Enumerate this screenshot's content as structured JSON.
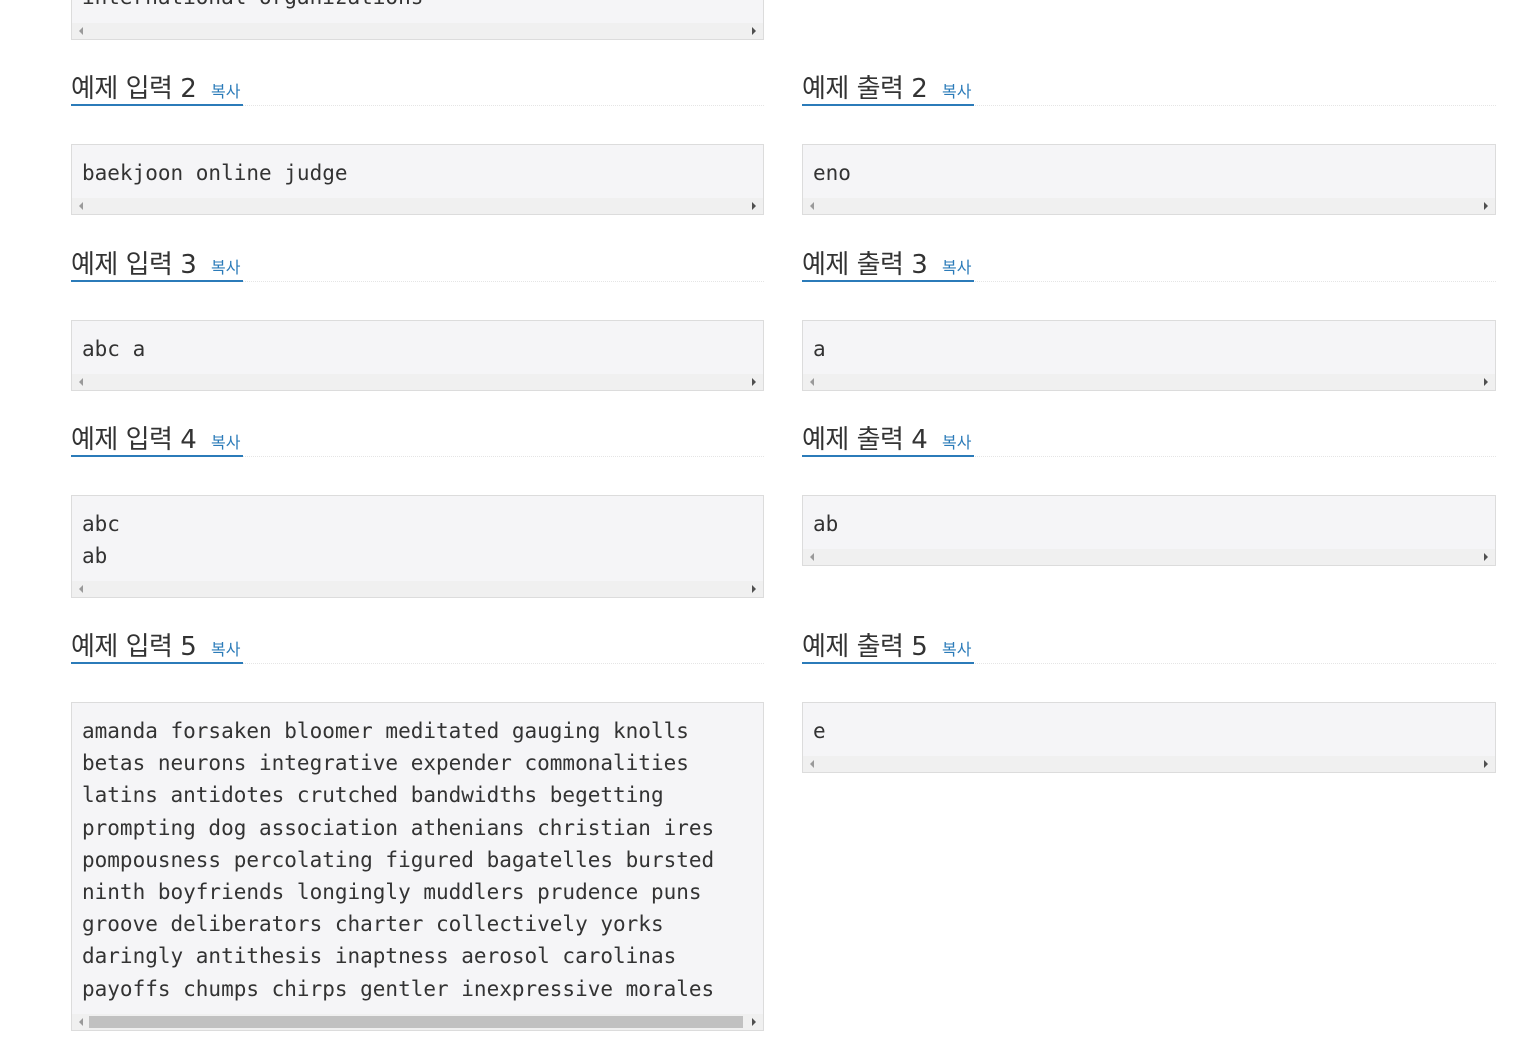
{
  "copy_label": "복사",
  "top_partial": {
    "text": "international organizations"
  },
  "inputs": [
    {
      "title": "예제 입력 2",
      "text": "baekjoon online judge"
    },
    {
      "title": "예제 입력 3",
      "text": "abc a"
    },
    {
      "title": "예제 입력 4",
      "text": "abc\nab"
    },
    {
      "title": "예제 입력 5",
      "text": "amanda forsaken bloomer meditated gauging knolls\nbetas neurons integrative expender commonalities\nlatins antidotes crutched bandwidths begetting\nprompting dog association athenians christian ires\npompousness percolating figured bagatelles bursted\nninth boyfriends longingly muddlers prudence puns\ngroove deliberators charter collectively yorks\ndaringly antithesis inaptness aerosol carolinas\npayoffs chumps chirps gentler inexpressive morales"
    }
  ],
  "outputs": [
    {
      "title": "예제 출력 2",
      "text": "eno"
    },
    {
      "title": "예제 출력 3",
      "text": "a"
    },
    {
      "title": "예제 출력 4",
      "text": "ab"
    },
    {
      "title": "예제 출력 5",
      "text": "e"
    }
  ]
}
